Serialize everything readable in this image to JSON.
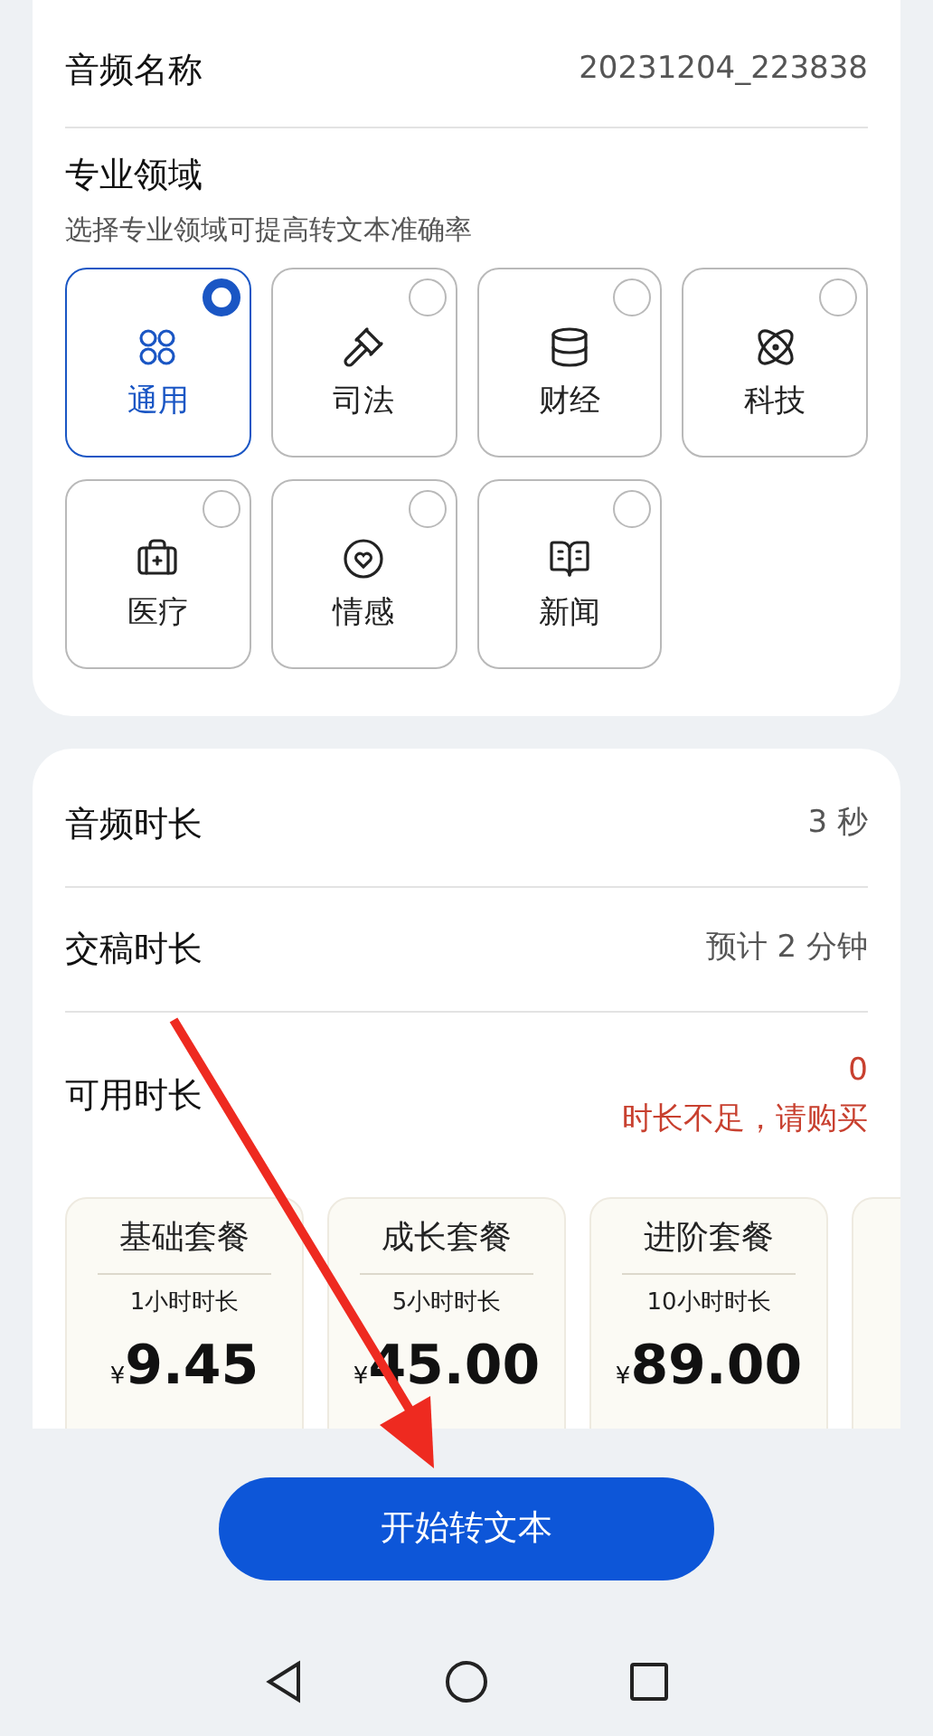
{
  "audio_name": {
    "label": "音频名称",
    "value": "20231204_223838"
  },
  "domain": {
    "title": "专业领域",
    "subtitle": "选择专业领域可提高转文本准确率",
    "options": [
      {
        "label": "通用",
        "selected": true
      },
      {
        "label": "司法",
        "selected": false
      },
      {
        "label": "财经",
        "selected": false
      },
      {
        "label": "科技",
        "selected": false
      },
      {
        "label": "医疗",
        "selected": false
      },
      {
        "label": "情感",
        "selected": false
      },
      {
        "label": "新闻",
        "selected": false
      }
    ]
  },
  "durations": [
    {
      "label": "音频时长",
      "value": "3 秒",
      "kind": "plain"
    },
    {
      "label": "交稿时长",
      "value": "预计 2 分钟",
      "kind": "plain"
    },
    {
      "label": "可用时长",
      "value": "0",
      "note": "时长不足，请购买",
      "kind": "warning"
    }
  ],
  "packages": [
    {
      "name": "基础套餐",
      "hours": "1小时时长",
      "currency": "¥",
      "price": "9.45"
    },
    {
      "name": "成长套餐",
      "hours": "5小时时长",
      "currency": "¥",
      "price": "45.00"
    },
    {
      "name": "进阶套餐",
      "hours": "10小时时长",
      "currency": "¥",
      "price": "89.00"
    }
  ],
  "start_button": "开始转文本"
}
